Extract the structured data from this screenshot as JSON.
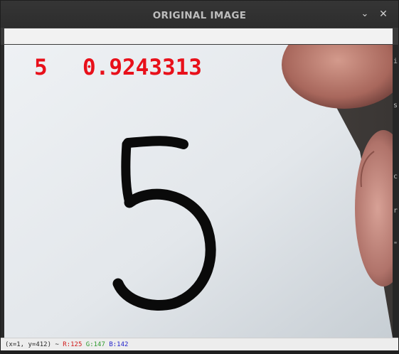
{
  "window": {
    "title": "ORIGINAL IMAGE",
    "minimize_glyph": "⌄",
    "close_glyph": "✕"
  },
  "overlay": {
    "predicted_label": "5",
    "confidence": "0.9243313",
    "color": "#e8101a"
  },
  "image": {
    "handwritten_digit": "5",
    "ink_color": "#0a0a0a",
    "paper_color": "#e6eaee"
  },
  "status": {
    "coords": "(x=1, y=412) ~",
    "r": "R:125",
    "g": "G:147",
    "b": "B:142"
  }
}
